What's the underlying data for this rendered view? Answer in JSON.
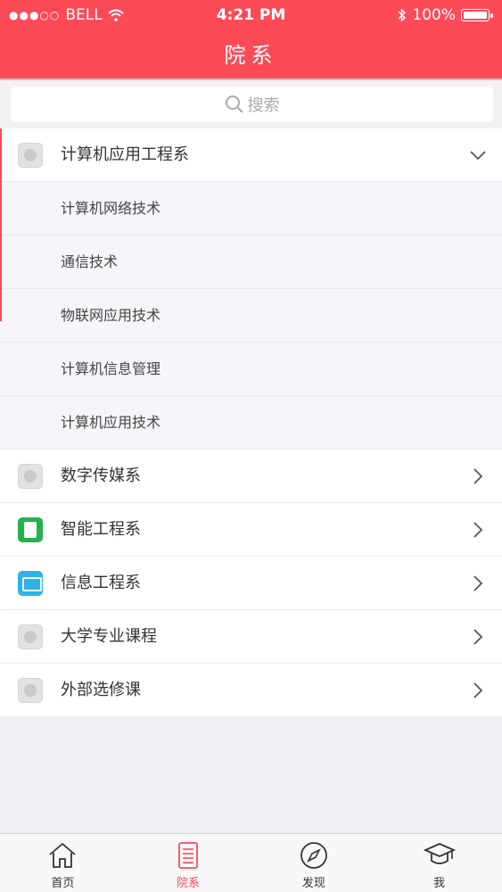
{
  "status_bar": {
    "signal_dots": "●●●○○",
    "carrier": "BELL",
    "time": "4:21 PM",
    "battery": "100%"
  },
  "header": {
    "title": "院系"
  },
  "search": {
    "placeholder": "搜索"
  },
  "departments": [
    {
      "label": "计算机应用工程系",
      "icon": "gray-logo-icon",
      "expanded": true,
      "children": [
        "计算机网络技术",
        "通信技术",
        "物联网应用技术",
        "计算机信息管理",
        "计算机应用技术"
      ]
    },
    {
      "label": "数字传媒系",
      "icon": "gray-logo-icon",
      "expanded": false
    },
    {
      "label": "智能工程系",
      "icon": "green-book-icon",
      "expanded": false
    },
    {
      "label": "信息工程系",
      "icon": "blue-monitor-icon",
      "expanded": false
    },
    {
      "label": "大学专业课程",
      "icon": "gray-logo-icon",
      "expanded": false
    },
    {
      "label": "外部选修课",
      "icon": "gray-logo-icon",
      "expanded": false
    }
  ],
  "tabbar": {
    "items": [
      {
        "label": "首页",
        "icon": "home-icon"
      },
      {
        "label": "院系",
        "icon": "list-icon",
        "active": true
      },
      {
        "label": "发现",
        "icon": "compass-icon"
      },
      {
        "label": "我",
        "icon": "graduation-cap-icon"
      }
    ]
  },
  "colors": {
    "brand": "#fc4a57",
    "background": "#efeff4"
  }
}
